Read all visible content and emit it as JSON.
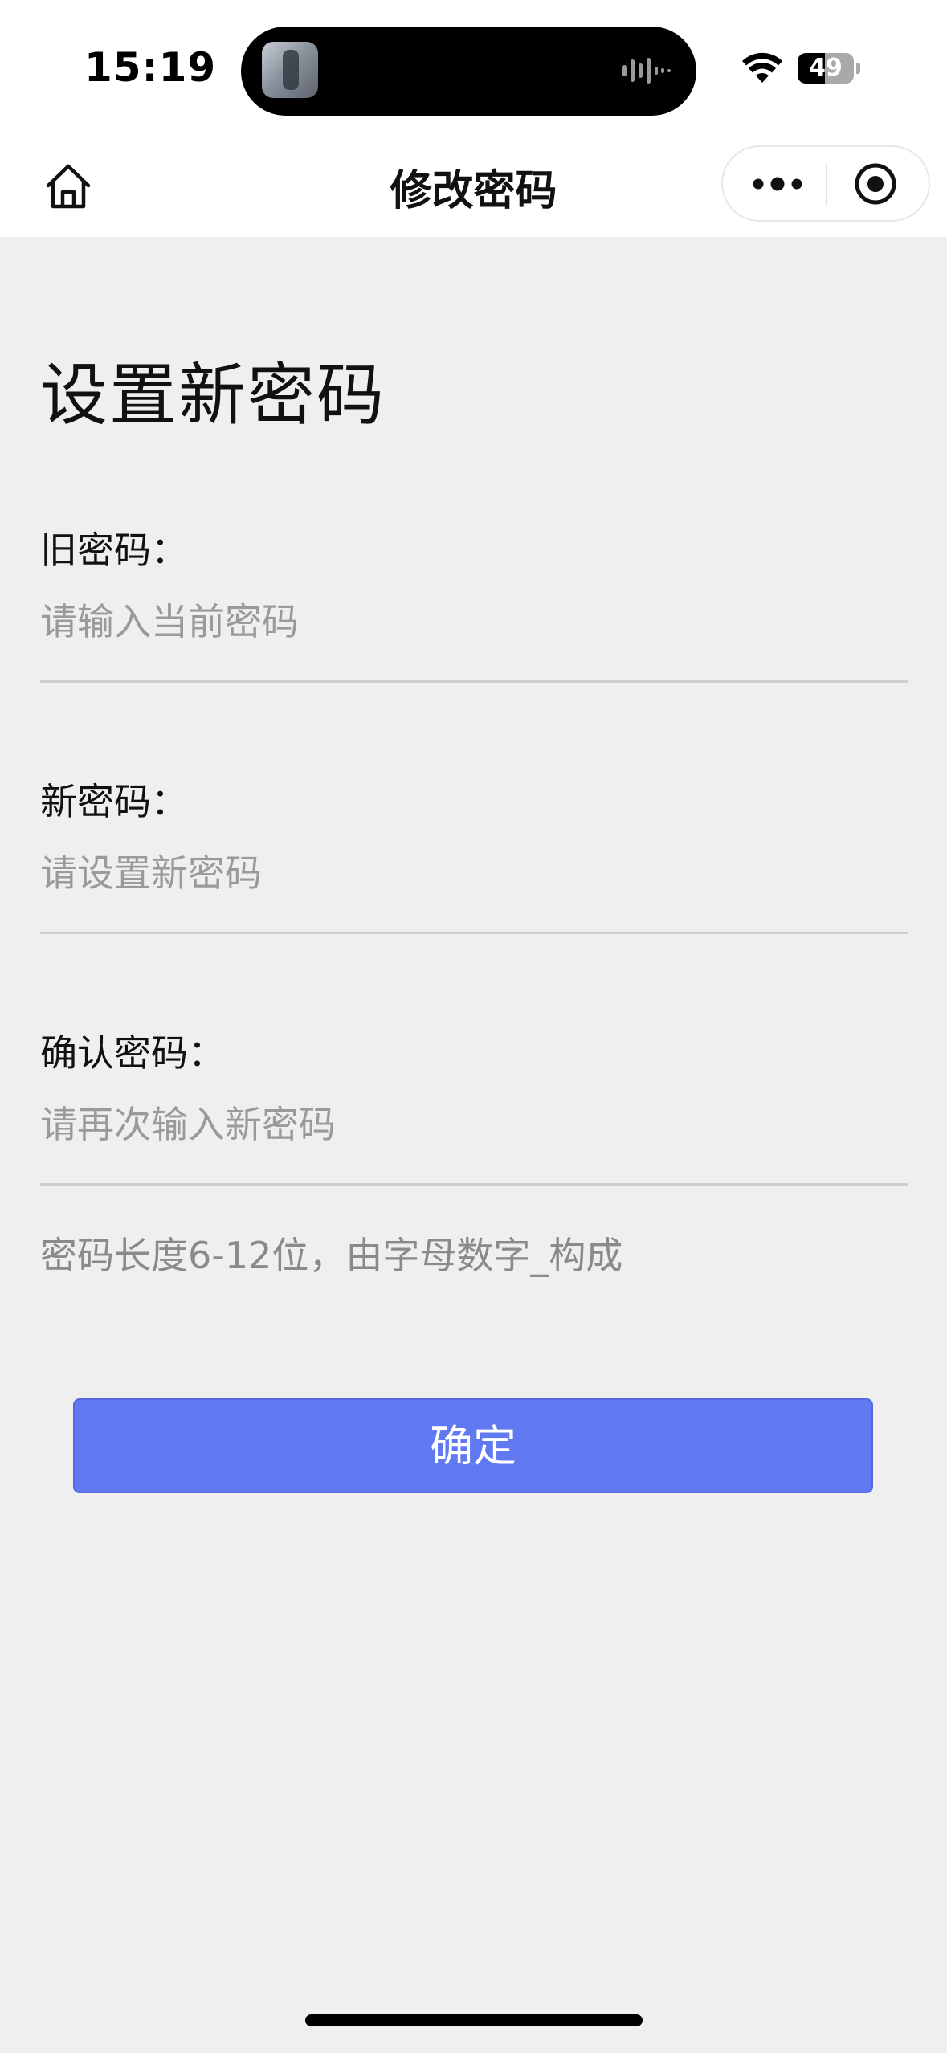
{
  "status_bar": {
    "time": "15:19",
    "battery_level": "49",
    "battery_fraction": 0.49
  },
  "nav": {
    "title": "修改密码",
    "home_icon": "home-icon",
    "more_icon": "more-dots-icon",
    "close_icon": "target-close-icon"
  },
  "form": {
    "heading": "设置新密码",
    "fields": [
      {
        "label": "旧密码：",
        "placeholder": "请输入当前密码"
      },
      {
        "label": "新密码：",
        "placeholder": "请设置新密码"
      },
      {
        "label": "确认密码：",
        "placeholder": "请再次输入新密码"
      }
    ],
    "hint": "密码长度6-12位，由字母数字_构成",
    "submit_label": "确定"
  },
  "colors": {
    "background": "#efefef",
    "accent": "#6079f1",
    "navbar": "#ffffff",
    "placeholder": "#9a9a9a"
  }
}
